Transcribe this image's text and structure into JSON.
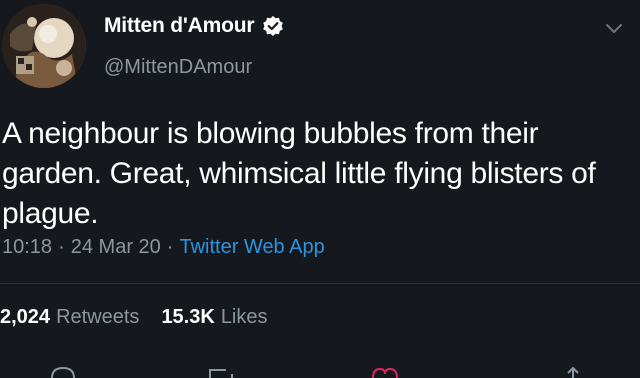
{
  "header": {
    "display_name": "Mitten d'Amour",
    "handle": "@MittenDAmour",
    "icons": [
      "verified-badge-icon",
      "chevron-down-icon"
    ]
  },
  "tweet": {
    "text": "A neighbour is blowing bubbles from their garden. Great, whimsical little flying blisters of plague.",
    "time": "10:18",
    "date": "24 Mar 20",
    "separator": "·",
    "source": "Twitter Web App"
  },
  "stats": {
    "retweets_count": "2,024",
    "retweets_label": "Retweets",
    "likes_count": "15.3K",
    "likes_label": "Likes"
  },
  "actions": {
    "icons": [
      "reply-icon",
      "retweet-icon",
      "like-icon",
      "share-icon"
    ]
  },
  "colors": {
    "background": "#15181c",
    "text": "#ffffff",
    "secondary": "#8d979f",
    "accent": "#2a95e0"
  }
}
